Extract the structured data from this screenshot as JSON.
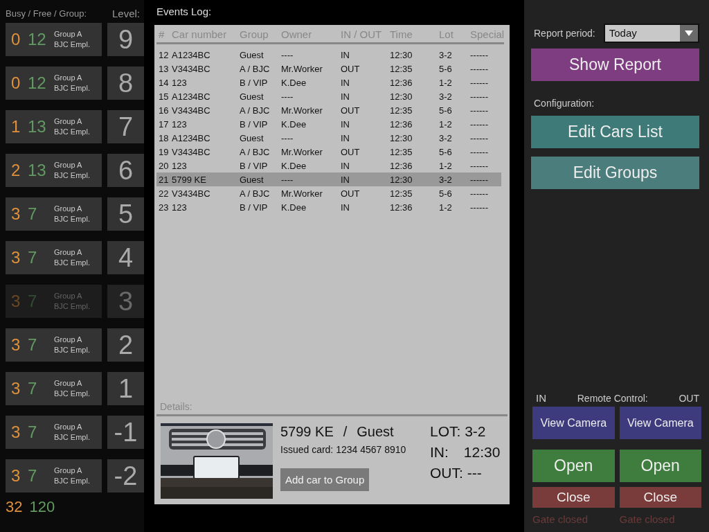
{
  "levels_panel": {
    "header_counts": "Busy / Free / Group:",
    "header_level": "Level:",
    "levels": [
      {
        "busy": "0",
        "free": "12",
        "group": "Group A",
        "subgroup": "BJC Empl.",
        "level": "9",
        "disabled": false
      },
      {
        "busy": "0",
        "free": "12",
        "group": "Group A",
        "subgroup": "BJC Empl.",
        "level": "8",
        "disabled": false
      },
      {
        "busy": "1",
        "free": "13",
        "group": "Group A",
        "subgroup": "BJC Empl.",
        "level": "7",
        "disabled": false
      },
      {
        "busy": "2",
        "free": "13",
        "group": "Group A",
        "subgroup": "BJC Empl.",
        "level": "6",
        "disabled": false
      },
      {
        "busy": "3",
        "free": "7",
        "group": "Group A",
        "subgroup": "BJC Empl.",
        "level": "5",
        "disabled": false
      },
      {
        "busy": "3",
        "free": "7",
        "group": "Group A",
        "subgroup": "BJC Empl.",
        "level": "4",
        "disabled": false
      },
      {
        "busy": "3",
        "free": "7",
        "group": "Group A",
        "subgroup": "BJC Empl.",
        "level": "3",
        "disabled": true
      },
      {
        "busy": "3",
        "free": "7",
        "group": "Group A",
        "subgroup": "BJC Empl.",
        "level": "2",
        "disabled": false
      },
      {
        "busy": "3",
        "free": "7",
        "group": "Group A",
        "subgroup": "BJC Empl.",
        "level": "1",
        "disabled": false
      },
      {
        "busy": "3",
        "free": "7",
        "group": "Group A",
        "subgroup": "BJC Empl.",
        "level": "-1",
        "disabled": false
      },
      {
        "busy": "3",
        "free": "7",
        "group": "Group A",
        "subgroup": "BJC Empl.",
        "level": "-2",
        "disabled": false
      }
    ],
    "totals": {
      "busy": "32",
      "free": "120"
    }
  },
  "events_log": {
    "title": "Events Log:",
    "columns": [
      "#",
      "Car number",
      "Group",
      "Owner",
      "IN / OUT",
      "Time",
      "Lot",
      "Special"
    ],
    "rows": [
      {
        "cells": [
          "12",
          "A1234BC",
          "Guest",
          "----",
          "IN",
          "12:30",
          "3-2",
          "------"
        ],
        "selected": false
      },
      {
        "cells": [
          "13",
          "V3434BC",
          "A / BJC",
          "Mr.Worker",
          "OUT",
          "12:35",
          "5-6",
          "------"
        ],
        "selected": false
      },
      {
        "cells": [
          "14",
          "123",
          "B /  VIP",
          "K.Dee",
          "IN",
          "12:36",
          "1-2",
          "------"
        ],
        "selected": false
      },
      {
        "cells": [
          "15",
          "A1234BC",
          "Guest",
          "----",
          "IN",
          "12:30",
          "3-2",
          "------"
        ],
        "selected": false
      },
      {
        "cells": [
          "16",
          "V3434BC",
          "A / BJC",
          "Mr.Worker",
          "OUT",
          "12:35",
          "5-6",
          "------"
        ],
        "selected": false
      },
      {
        "cells": [
          "17",
          "123",
          "B /  VIP",
          "K.Dee",
          "IN",
          "12:36",
          "1-2",
          "------"
        ],
        "selected": false
      },
      {
        "cells": [
          "18",
          "A1234BC",
          "Guest",
          "----",
          "IN",
          "12:30",
          "3-2",
          "------"
        ],
        "selected": false
      },
      {
        "cells": [
          "19",
          "V3434BC",
          "A / BJC",
          "Mr.Worker",
          "OUT",
          "12:35",
          "5-6",
          "------"
        ],
        "selected": false
      },
      {
        "cells": [
          "20",
          "123",
          "B /  VIP",
          "K.Dee",
          "IN",
          "12:36",
          "1-2",
          "------"
        ],
        "selected": false
      },
      {
        "cells": [
          "21",
          "5799 KE",
          "Guest",
          "----",
          "IN",
          "12:30",
          "3-2",
          "------"
        ],
        "selected": true
      },
      {
        "cells": [
          "22",
          "V3434BC",
          "A / BJC",
          "Mr.Worker",
          "OUT",
          "12:35",
          "5-6",
          "------"
        ],
        "selected": false
      },
      {
        "cells": [
          "23",
          "123",
          "B /  VIP",
          "K.Dee",
          "IN",
          "12:36",
          "1-2",
          "------"
        ],
        "selected": false
      }
    ],
    "details": {
      "title": "Details:",
      "car": "5799 KE",
      "separator": "/",
      "group": "Guest",
      "card": "Issued card: 1234 4567 8910",
      "button": "Add car to Group",
      "lot": "LOT: 3-2",
      "in_label": "IN:",
      "in_time": "12:30",
      "out": "OUT: ---"
    }
  },
  "sidebar": {
    "report_label": "Report period:",
    "report_period": "Today",
    "show_report": "Show Report",
    "config_label": "Configuration:",
    "config_buttons": [
      "Edit Cars List",
      "Edit Groups"
    ],
    "remote": {
      "in_label": "IN",
      "title": "Remote Control:",
      "out_label": "OUT",
      "gates": [
        {
          "view": "View Camera",
          "open": "Open",
          "close": "Close",
          "status": "Gate closed"
        },
        {
          "view": "View Camera",
          "open": "Open",
          "close": "Close",
          "status": "Gate closed"
        }
      ]
    }
  }
}
